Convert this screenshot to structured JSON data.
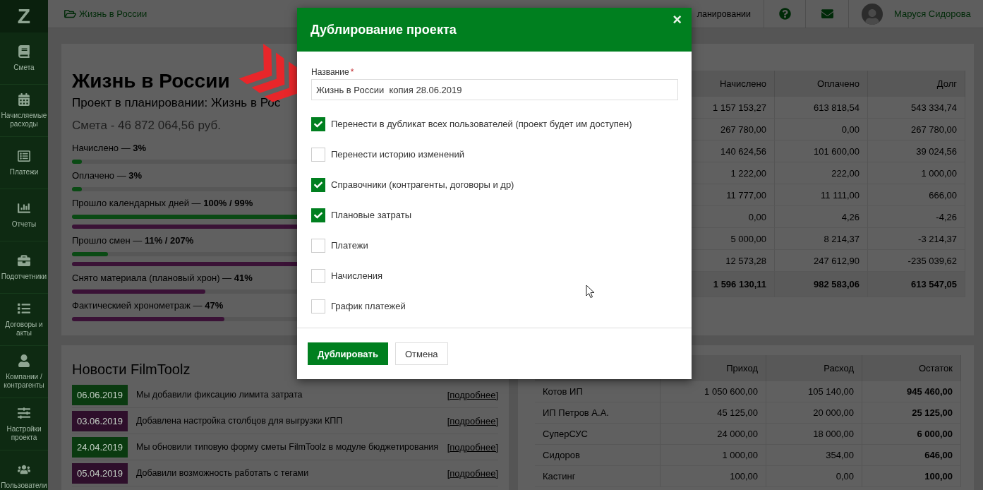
{
  "logo": "Z",
  "sidebar": {
    "items": [
      {
        "label": "Смета"
      },
      {
        "label": "Начисляемые расходы"
      },
      {
        "label": "Платежи"
      },
      {
        "label": "Отчеты"
      },
      {
        "label": "Подотчетники"
      },
      {
        "label": "Договоры и акты"
      },
      {
        "label": "Компании / контрагенты"
      },
      {
        "label": "Настройки проекта"
      },
      {
        "label": "Пользователи"
      }
    ]
  },
  "top_bar": {
    "breadcrumb": "Жизнь в России",
    "project_status": "ланировании",
    "user_name": "Маруся Сидорова"
  },
  "project": {
    "title": "Жизнь в России",
    "subtitle": "Проект в планировании: Жизнь в Рос",
    "budget": "Смета - 46 872 064,56 руб.",
    "progress": [
      {
        "label": "Начислено — **3%**",
        "bars": [
          {
            "color": "#0a4a14",
            "level": 0.03
          }
        ]
      },
      {
        "label": "Оплачено — **3%**",
        "bars": [
          {
            "color": "#0a4a14",
            "level": 0.03
          }
        ]
      },
      {
        "label": "Прошло календарных дней — **100% / 99%**",
        "bars": [
          {
            "color": "#0a4a14",
            "level": 1
          },
          {
            "color": "#3a1236",
            "level": 0.99
          }
        ]
      },
      {
        "label": "Прошло смен — **11% / 207%**",
        "bars": [
          {
            "color": "#0a4a14",
            "level": 0.11
          },
          {
            "color": "#3a1236",
            "level": 1
          }
        ]
      },
      {
        "label": "Снято материала (плановый хрон) — **41%**",
        "bars": [
          {
            "color": "#3a1236",
            "level": 0.41
          }
        ]
      },
      {
        "label": "Фактическией хронометраж — **47%**",
        "bars": [
          {
            "color": "#3a1236",
            "level": 0.47
          }
        ]
      }
    ]
  },
  "budget_table": {
    "columns": [
      "Начислено",
      "Оплачено",
      "Долг"
    ],
    "rows": [
      [
        "1 157 153,27",
        "613 818,54",
        "543 334,74"
      ],
      [
        "267 780,00",
        "0,00",
        "267 780,00"
      ],
      [
        "140 624,56",
        "101 600,00",
        "39 024,56"
      ],
      [
        "1 222,00",
        "222,00",
        "1 000,00"
      ],
      [
        "11 777,00",
        "11 111,00",
        "666,00"
      ],
      [
        "0,00",
        "4,26",
        "-4,26"
      ],
      [
        "5 000,00",
        "8 214,37",
        "-3 214,37"
      ],
      [
        "12 573,28",
        "247 612,90",
        "-235 039,62"
      ]
    ],
    "total": [
      "1 596 130,11",
      "982 583,06",
      "613 547,05"
    ]
  },
  "news": {
    "title": "Новости FilmToolz",
    "items": [
      {
        "date": "06.06.2019",
        "color": "#0a3a10",
        "text": "Мы добавили фиксацию лимита затрата",
        "link": "[подробнее]"
      },
      {
        "date": "03.06.2019",
        "color": "#2e0f2b",
        "text": "Добавлена настройка столбцов для выгрузки КПП",
        "link": "[подробнее]"
      },
      {
        "date": "24.04.2019",
        "color": "#0a3a10",
        "text": "Мы обновили типовую форму сметы FilmToolz в модуле бюджетирования",
        "link": "[подробнее]"
      },
      {
        "date": "05.04.2019",
        "color": "#2e0f2b",
        "text": "Добавили возможность работать с тегами",
        "link": "[подробнее]"
      }
    ]
  },
  "counterparties_table": {
    "columns": [
      "",
      "Приход",
      "Расход",
      "Остаток"
    ],
    "rows": [
      [
        "Котов ИП",
        "1 050 600,00",
        "105 140,00",
        "945 460,00"
      ],
      [
        "ИП Петров А.А.",
        "45 125,00",
        "20 000,00",
        "25 125,00"
      ],
      [
        "СуперСУС",
        "24 000,00",
        "18 000,00",
        "6 000,00"
      ],
      [
        "Сидоров",
        "1 000,00",
        "354,00",
        "646,00"
      ],
      [
        "Кастинг",
        "100,00",
        "0,00",
        "100,00"
      ]
    ]
  },
  "dialog": {
    "title": "Дублирование проекта",
    "close": "×",
    "field": {
      "label": "Название",
      "required_mark": "*",
      "value": "Жизнь в России  копия 28.06.2019"
    },
    "options": [
      {
        "label": "Перенести в дубликат всех пользователей (проект будет им доступен)",
        "checked": true
      },
      {
        "label": "Перенести историю изменений",
        "checked": false
      },
      {
        "label": "Справочники (контрагенты, договоры и др)",
        "checked": true
      },
      {
        "label": "Плановые затраты",
        "checked": true
      },
      {
        "label": "Платежи",
        "checked": false
      },
      {
        "label": "Начисления",
        "checked": false
      },
      {
        "label": "График платежей",
        "checked": false
      }
    ],
    "buttons": [
      {
        "label": "Дублировать",
        "kind": "primary"
      },
      {
        "label": "Отмена",
        "kind": "secondary"
      }
    ]
  }
}
